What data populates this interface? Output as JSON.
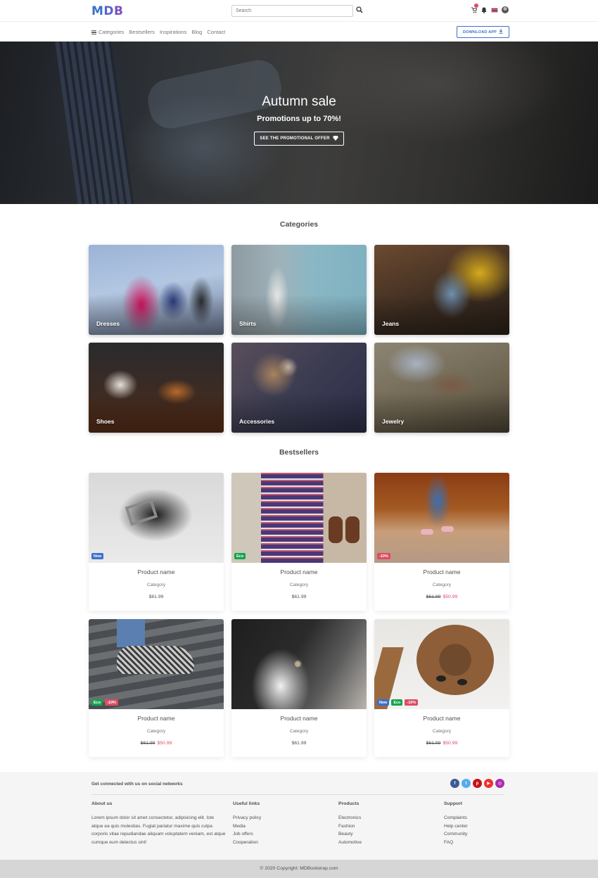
{
  "topbar": {
    "logo": {
      "m": "M",
      "d": "D",
      "b": "B"
    },
    "search_placeholder": "Search",
    "icons": [
      "cart-icon",
      "bell-icon",
      "flag-icon",
      "avatar"
    ]
  },
  "nav": {
    "items": [
      "Categories",
      "Bestsellers",
      "Inspirations",
      "Blog",
      "Contact"
    ],
    "download_label": "DOWNLOAD APP"
  },
  "hero": {
    "title": "Autumn sale",
    "subtitle": "Promotions up to 70%!",
    "button_label": "SEE THE PROMOTIONAL OFFER"
  },
  "categories": {
    "title": "Categories",
    "items": [
      "Dresses",
      "Shirts",
      "Jeans",
      "Shoes",
      "Accessories",
      "Jewelry"
    ]
  },
  "bestsellers": {
    "title": "Bestsellers",
    "products": [
      {
        "name": "Product name",
        "category": "Category",
        "price": "$61.99",
        "old_price": "",
        "badges": [
          "New"
        ]
      },
      {
        "name": "Product name",
        "category": "Category",
        "price": "$61.99",
        "old_price": "",
        "badges": [
          "Eco"
        ]
      },
      {
        "name": "Product name",
        "category": "Category",
        "price": "$50.99",
        "old_price": "$61.99",
        "badges": [
          "-10%"
        ]
      },
      {
        "name": "Product name",
        "category": "Category",
        "price": "$50.99",
        "old_price": "$61.99",
        "badges": [
          "Eco",
          "-10%"
        ]
      },
      {
        "name": "Product name",
        "category": "Category",
        "price": "$61.99",
        "old_price": "",
        "badges": []
      },
      {
        "name": "Product name",
        "category": "Category",
        "price": "$50.99",
        "old_price": "$61.99",
        "badges": [
          "New",
          "Eco",
          "-10%"
        ]
      }
    ]
  },
  "footer": {
    "social_text": "Get connected with us on social networks",
    "social_icons": [
      {
        "name": "facebook-icon",
        "glyph": "f",
        "color": "#3b5998"
      },
      {
        "name": "twitter-icon",
        "glyph": "t",
        "color": "#55acee"
      },
      {
        "name": "pinterest-icon",
        "glyph": "p",
        "color": "#c61118"
      },
      {
        "name": "youtube-icon",
        "glyph": "▶",
        "color": "#ed302f"
      },
      {
        "name": "instagram-icon",
        "glyph": "◎",
        "color": "#ac2bac"
      }
    ],
    "about": {
      "title": "About us",
      "text": "Lorem ipsum dolor sit amet consectetur, adipisicing elit. Iste atque ea quis molestias. Fugiat pariatur maxime quis culpa corporis vitae repudiandae aliquam voluptatem veniam, est atque cumque eum delectus sint!"
    },
    "useful": {
      "title": "Useful links",
      "items": [
        "Privacy policy",
        "Media",
        "Job offers",
        "Cooperation"
      ]
    },
    "products": {
      "title": "Products",
      "items": [
        "Electronics",
        "Fashion",
        "Beauty",
        "Automotive"
      ]
    },
    "support": {
      "title": "Support",
      "items": [
        "Complaints",
        "Help center",
        "Community",
        "FAQ"
      ]
    },
    "copyright": "© 2020 Copyright: ",
    "copyright_link": "MDBootstrap.com"
  },
  "colors": {
    "primary": "#3b71ca",
    "danger": "#dc4c64",
    "success": "#14a44d"
  }
}
